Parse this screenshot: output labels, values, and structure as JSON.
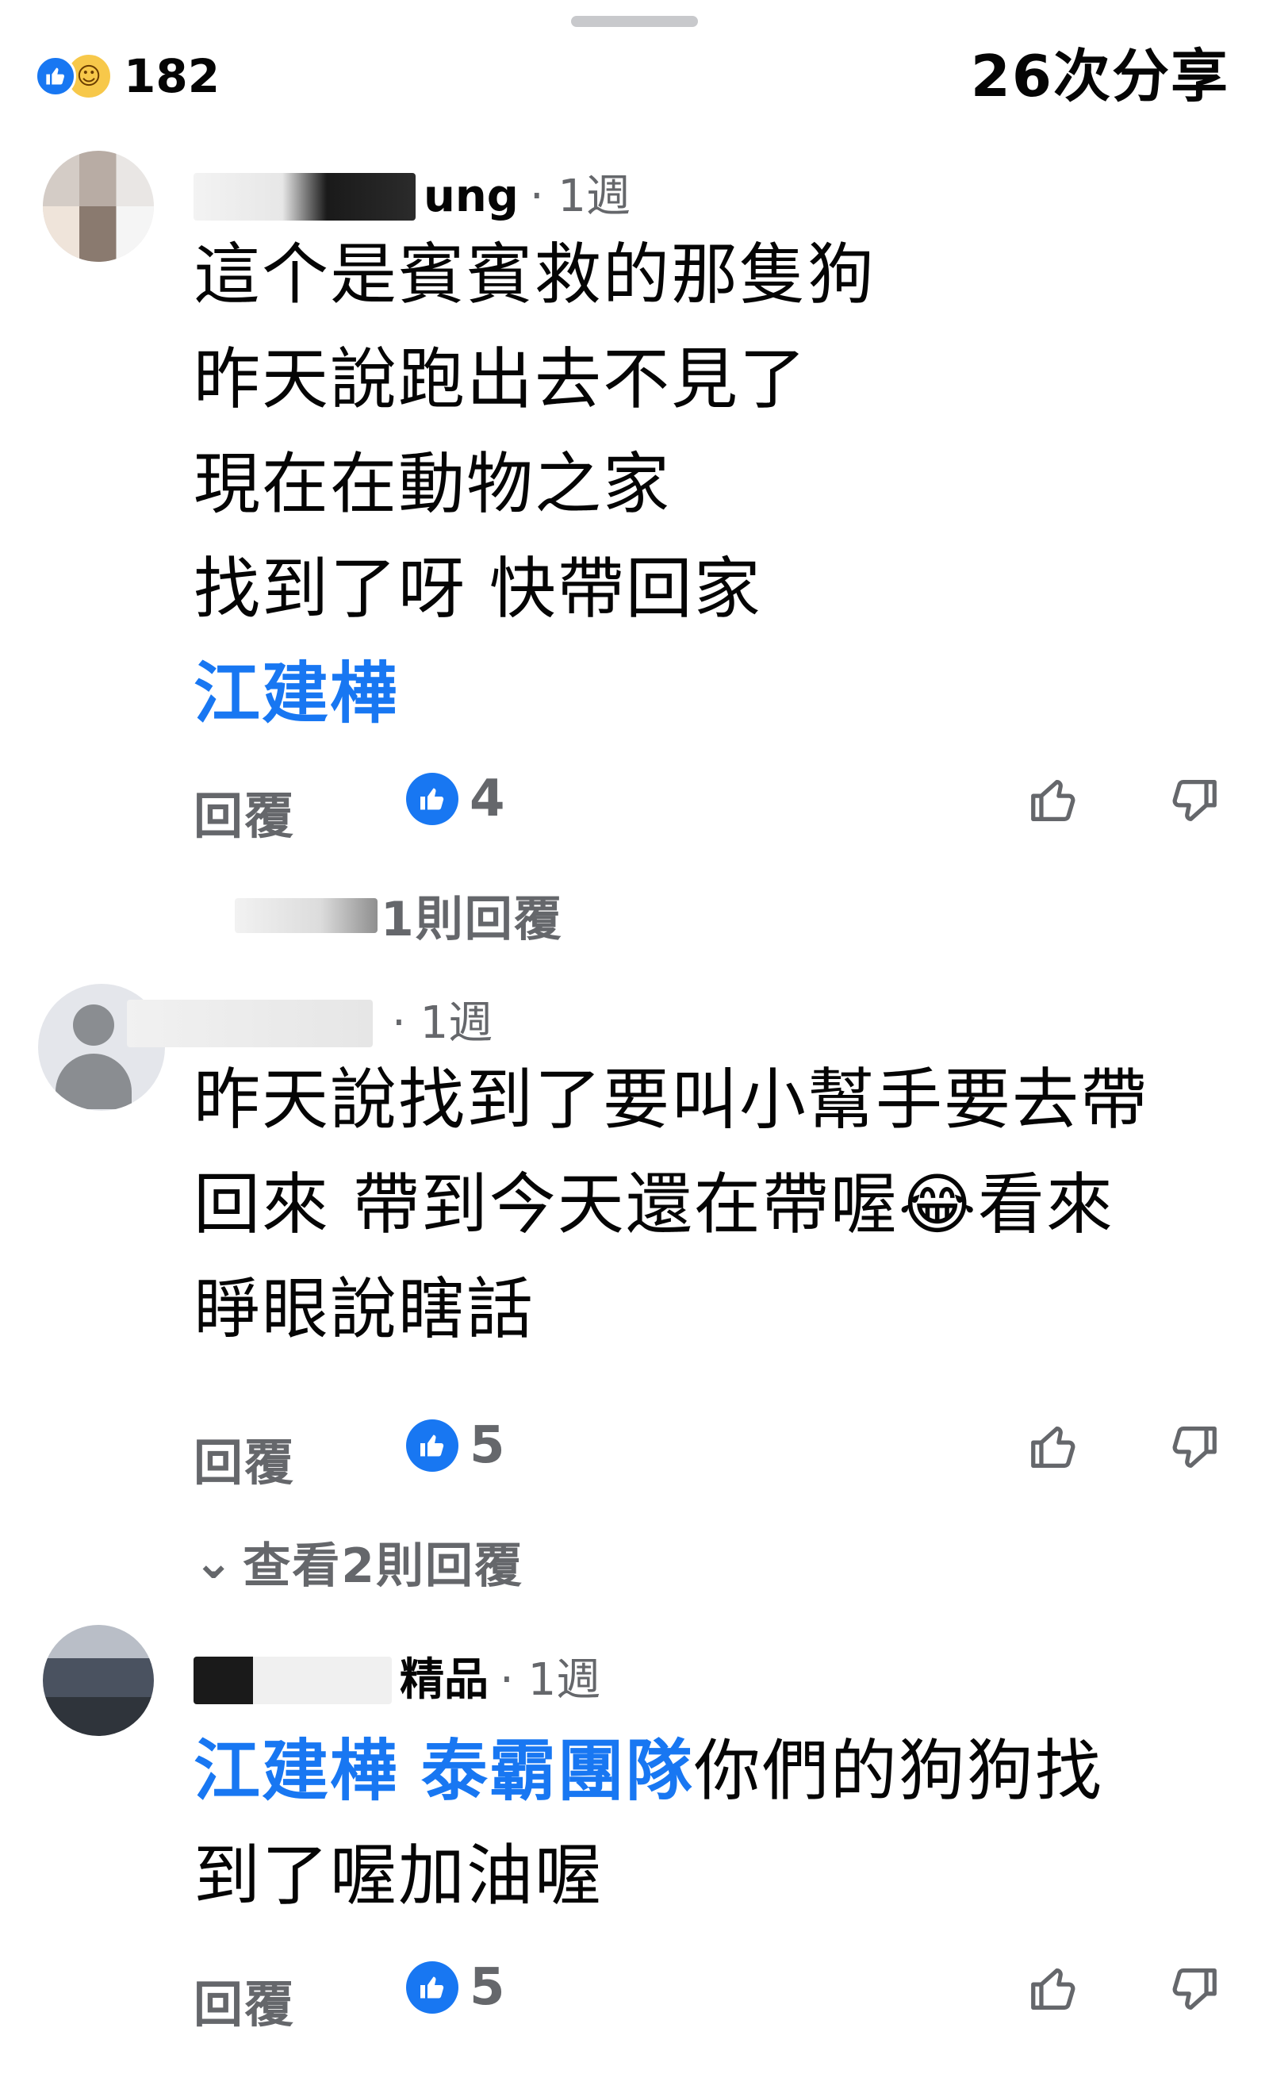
{
  "header": {
    "reaction_count": "182",
    "share_count": "26次分享"
  },
  "comments": [
    {
      "name_suffix": "ung",
      "time": "· 1週",
      "lines": [
        "這个是賓賓救的那隻狗",
        "昨天說跑出去不見了",
        "現在在動物之家",
        "找到了呀 快帶回家"
      ],
      "mention_line": "江建樺",
      "reply_label": "回覆",
      "likes": "4",
      "view_replies": "1則回覆"
    },
    {
      "name_suffix": "",
      "time": "· 1週",
      "lines": [
        "昨天說找到了要叫小幫手要去帶",
        "回來  帶到今天還在帶喔",
        "睜眼說瞎話"
      ],
      "emoji": "😂",
      "emoji_tail": "看來",
      "reply_label": "回覆",
      "likes": "5",
      "view_replies": "查看2則回覆"
    },
    {
      "name_suffix": "精品",
      "time": "· 1週",
      "mentions": [
        "江建樺",
        "泰霸團隊"
      ],
      "line1_tail": "你們的狗狗找",
      "line2": "到了喔加油喔",
      "reply_label": "回覆",
      "likes": "5"
    }
  ],
  "icons": {
    "like": "thumbs-up-icon",
    "upvote": "thumb-up-outline-icon",
    "downvote": "thumb-down-outline-icon"
  },
  "colors": {
    "accent": "#1877f2",
    "secondary_text": "#65676b"
  }
}
